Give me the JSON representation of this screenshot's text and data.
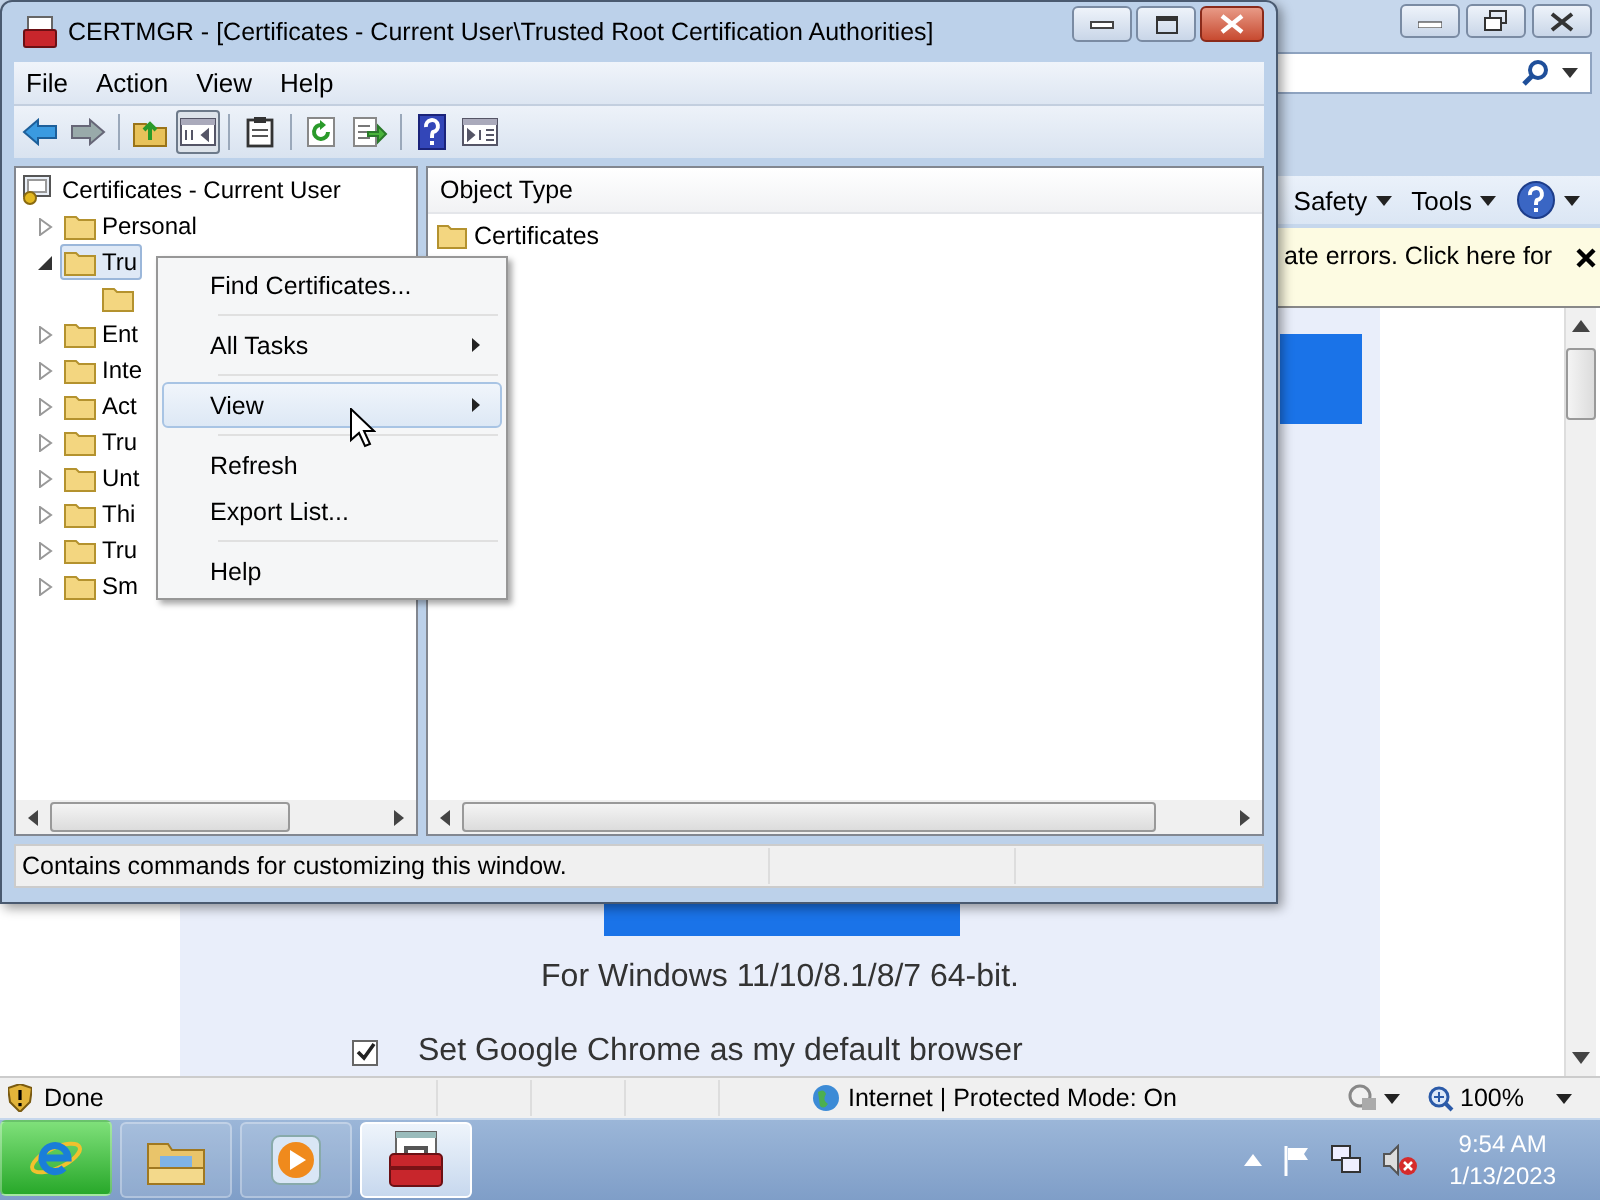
{
  "browser": {
    "command_bar": [
      {
        "label": "Safety"
      },
      {
        "label": "Tools"
      }
    ],
    "info_bar": {
      "text": "ate errors. Click here for"
    },
    "page": {
      "caption": "For Windows 11/10/8.1/8/7 64-bit.",
      "default_checkbox": {
        "label": "Set Google Chrome as my default browser",
        "checked": true
      }
    },
    "status_bar": {
      "text": "Done",
      "zone": "Internet | Protected Mode: On",
      "zoom": "100%"
    }
  },
  "window": {
    "title": "CERTMGR - [Certificates - Current User\\Trusted Root Certification Authorities]",
    "menu": [
      "File",
      "Action",
      "View",
      "Help"
    ],
    "toolbar": [
      {
        "kind": "back",
        "pressed": false
      },
      {
        "kind": "forward",
        "pressed": false
      },
      {
        "kind": "sep"
      },
      {
        "kind": "up",
        "pressed": false
      },
      {
        "kind": "tree",
        "pressed": true
      },
      {
        "kind": "sep"
      },
      {
        "kind": "clipboard",
        "pressed": false
      },
      {
        "kind": "sep"
      },
      {
        "kind": "refresh",
        "pressed": false
      },
      {
        "kind": "export",
        "pressed": false
      },
      {
        "kind": "sep"
      },
      {
        "kind": "help",
        "pressed": false
      },
      {
        "kind": "pane",
        "pressed": false
      }
    ],
    "tree": {
      "label": "Certificates - Current User",
      "children": [
        {
          "label": "Personal",
          "expanded": false,
          "selected": false
        },
        {
          "label": "Tru",
          "expanded": true,
          "selected": true,
          "children": [
            {
              "selected": false
            }
          ]
        },
        {
          "label": "Ent",
          "expanded": false,
          "selected": false
        },
        {
          "label": "Inte",
          "expanded": false,
          "selected": false
        },
        {
          "label": "Act",
          "expanded": false,
          "selected": false
        },
        {
          "label": "Tru",
          "expanded": false,
          "selected": false
        },
        {
          "label": "Unt",
          "expanded": false,
          "selected": false
        },
        {
          "label": "Thi",
          "expanded": false,
          "selected": false
        },
        {
          "label": "Tru",
          "expanded": false,
          "selected": false
        },
        {
          "label": "Sm",
          "expanded": false,
          "selected": false
        }
      ]
    },
    "list": {
      "columns": [
        "Object Type"
      ],
      "rows": [
        "Certificates"
      ]
    },
    "status_bar": "Contains commands for customizing this window."
  },
  "context_menu": [
    {
      "kind": "item",
      "label": "Find Certificates...",
      "submenu": false,
      "selected": false
    },
    {
      "kind": "separator"
    },
    {
      "kind": "item",
      "label": "All Tasks",
      "submenu": true,
      "selected": false
    },
    {
      "kind": "separator"
    },
    {
      "kind": "item",
      "label": "View",
      "submenu": true,
      "selected": true
    },
    {
      "kind": "separator"
    },
    {
      "kind": "item",
      "label": "Refresh",
      "submenu": false,
      "selected": false
    },
    {
      "kind": "item",
      "label": "Export List...",
      "submenu": false,
      "selected": false
    },
    {
      "kind": "separator"
    },
    {
      "kind": "item",
      "label": "Help",
      "submenu": false,
      "selected": false
    }
  ],
  "taskbar": {
    "buttons": [
      {
        "kind": "ie",
        "selected": false
      },
      {
        "kind": "explorer",
        "selected": false
      },
      {
        "kind": "media",
        "selected": false
      },
      {
        "kind": "toolbox",
        "selected": true
      }
    ],
    "time": "9:54 AM",
    "date": "1/13/2023"
  }
}
